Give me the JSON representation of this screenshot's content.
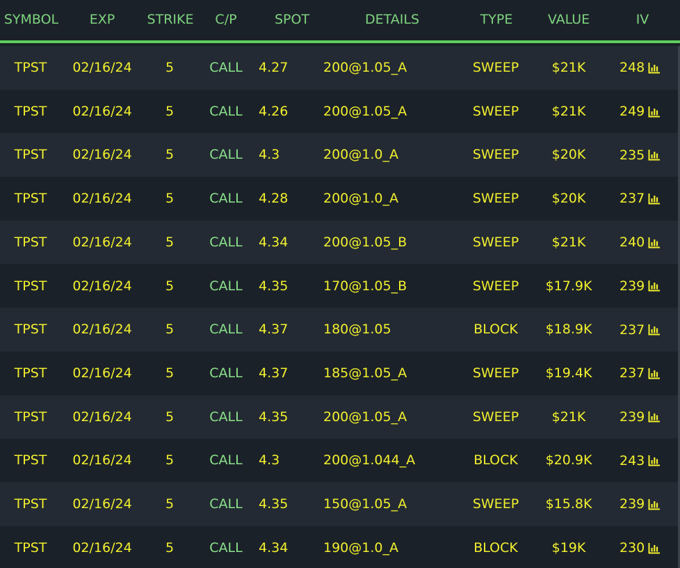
{
  "columns": {
    "symbol": "SYMBOL",
    "exp": "EXP",
    "strike": "STRIKE",
    "cp": "C/P",
    "spot": "SPOT",
    "details": "DETAILS",
    "type": "TYPE",
    "value": "VALUE",
    "iv": "IV"
  },
  "colors": {
    "header_text": "#7fd47f",
    "header_rule": "#5cd05c",
    "cell_text": "#f2f02e",
    "cp_text": "#8be28b",
    "row_dark": "#1b2129",
    "row_light": "#232a33"
  },
  "iv_icon": "bar-chart-icon",
  "rows": [
    {
      "symbol": "TPST",
      "exp": "02/16/24",
      "strike": "5",
      "cp": "CALL",
      "spot": "4.27",
      "details": "200@1.05_A",
      "type": "SWEEP",
      "value": "$21K",
      "iv": "248"
    },
    {
      "symbol": "TPST",
      "exp": "02/16/24",
      "strike": "5",
      "cp": "CALL",
      "spot": "4.26",
      "details": "200@1.05_A",
      "type": "SWEEP",
      "value": "$21K",
      "iv": "249"
    },
    {
      "symbol": "TPST",
      "exp": "02/16/24",
      "strike": "5",
      "cp": "CALL",
      "spot": "4.3",
      "details": "200@1.0_A",
      "type": "SWEEP",
      "value": "$20K",
      "iv": "235"
    },
    {
      "symbol": "TPST",
      "exp": "02/16/24",
      "strike": "5",
      "cp": "CALL",
      "spot": "4.28",
      "details": "200@1.0_A",
      "type": "SWEEP",
      "value": "$20K",
      "iv": "237"
    },
    {
      "symbol": "TPST",
      "exp": "02/16/24",
      "strike": "5",
      "cp": "CALL",
      "spot": "4.34",
      "details": "200@1.05_B",
      "type": "SWEEP",
      "value": "$21K",
      "iv": "240"
    },
    {
      "symbol": "TPST",
      "exp": "02/16/24",
      "strike": "5",
      "cp": "CALL",
      "spot": "4.35",
      "details": "170@1.05_B",
      "type": "SWEEP",
      "value": "$17.9K",
      "iv": "239"
    },
    {
      "symbol": "TPST",
      "exp": "02/16/24",
      "strike": "5",
      "cp": "CALL",
      "spot": "4.37",
      "details": "180@1.05",
      "type": "BLOCK",
      "value": "$18.9K",
      "iv": "237"
    },
    {
      "symbol": "TPST",
      "exp": "02/16/24",
      "strike": "5",
      "cp": "CALL",
      "spot": "4.37",
      "details": "185@1.05_A",
      "type": "SWEEP",
      "value": "$19.4K",
      "iv": "237"
    },
    {
      "symbol": "TPST",
      "exp": "02/16/24",
      "strike": "5",
      "cp": "CALL",
      "spot": "4.35",
      "details": "200@1.05_A",
      "type": "SWEEP",
      "value": "$21K",
      "iv": "239"
    },
    {
      "symbol": "TPST",
      "exp": "02/16/24",
      "strike": "5",
      "cp": "CALL",
      "spot": "4.3",
      "details": "200@1.044_A",
      "type": "BLOCK",
      "value": "$20.9K",
      "iv": "243"
    },
    {
      "symbol": "TPST",
      "exp": "02/16/24",
      "strike": "5",
      "cp": "CALL",
      "spot": "4.35",
      "details": "150@1.05_A",
      "type": "SWEEP",
      "value": "$15.8K",
      "iv": "239"
    },
    {
      "symbol": "TPST",
      "exp": "02/16/24",
      "strike": "5",
      "cp": "CALL",
      "spot": "4.34",
      "details": "190@1.0_A",
      "type": "BLOCK",
      "value": "$19K",
      "iv": "230"
    }
  ]
}
